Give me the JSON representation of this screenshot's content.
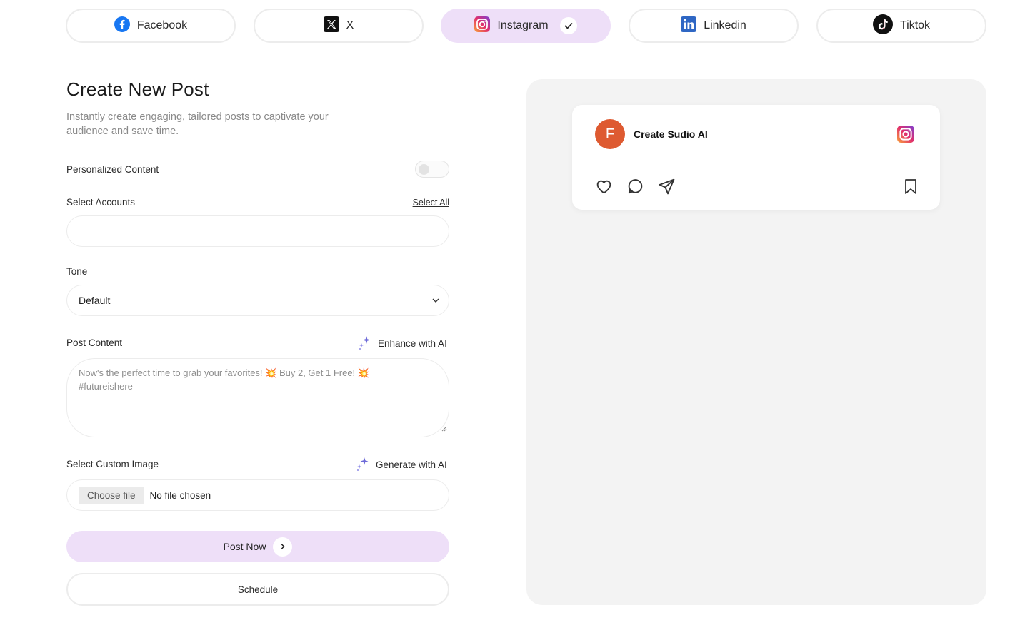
{
  "platforms": [
    {
      "label": "Facebook",
      "icon": "facebook-icon"
    },
    {
      "label": "X",
      "icon": "x-icon"
    },
    {
      "label": "Instagram",
      "icon": "instagram-icon",
      "selected": true
    },
    {
      "label": "Linkedin",
      "icon": "linkedin-icon"
    },
    {
      "label": "Tiktok",
      "icon": "tiktok-icon"
    }
  ],
  "form": {
    "title": "Create New Post",
    "subtitle": "Instantly create engaging, tailored posts to captivate your audience and save time.",
    "personalized_label": "Personalized Content",
    "personalized_enabled": false,
    "accounts_label": "Select Accounts",
    "select_all": "Select All",
    "accounts_value": "",
    "tone_label": "Tone",
    "tone_value": "Default",
    "content_label": "Post Content",
    "enhance_label": "Enhance with AI",
    "content_placeholder": "Now's the perfect time to grab your favorites! 💥 Buy 2, Get 1 Free! 💥 #futureishere",
    "image_label": "Select Custom Image",
    "generate_label": "Generate with AI",
    "choose_file": "Choose file",
    "no_file": "No file chosen",
    "post_now": "Post Now",
    "schedule": "Schedule"
  },
  "preview": {
    "avatar_letter": "F",
    "account_name": "Create Sudio AI"
  },
  "colors": {
    "accent": "#eedff8",
    "avatar": "#de5a31",
    "facebook": "#1877f2",
    "linkedin": "#2f67c4"
  }
}
